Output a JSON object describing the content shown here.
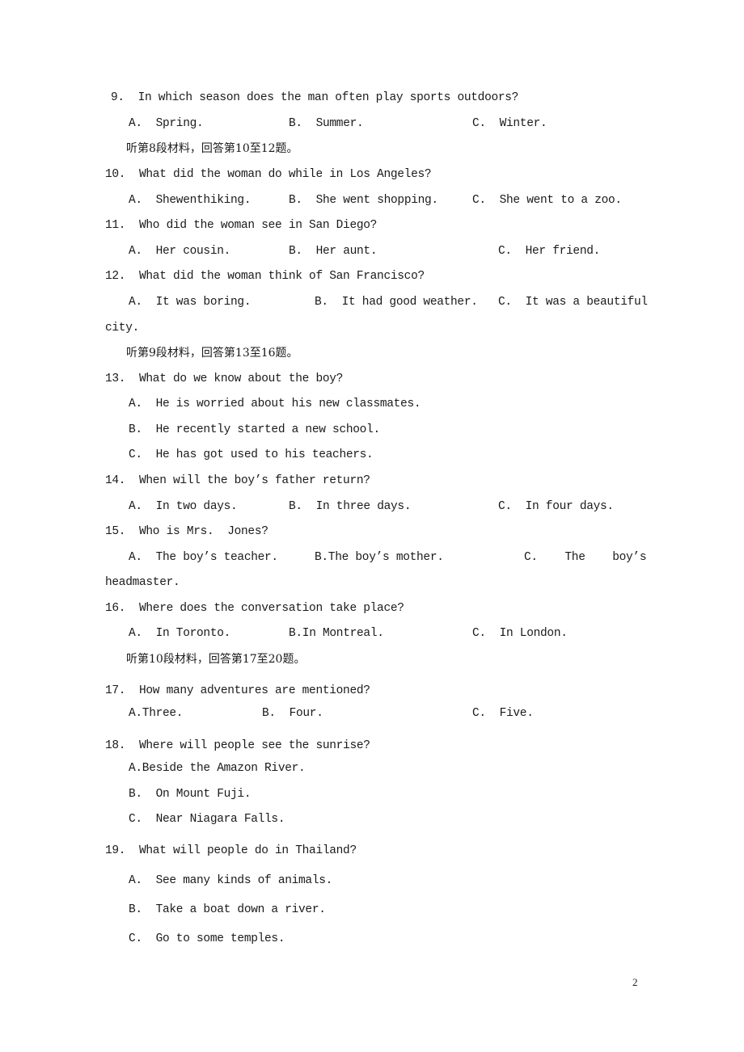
{
  "document": {
    "page_number": "2",
    "lines": [
      {
        "id": "q9",
        "text": "9.  In which season does the man often play sports outdoors?"
      },
      {
        "id": "q9a",
        "text": "A.  Spring."
      },
      {
        "id": "q9b",
        "text": "B.  Summer."
      },
      {
        "id": "q9c",
        "text": "C.  Winter."
      },
      {
        "id": "s8",
        "text": "听第8段材料，回答第10至12题。"
      },
      {
        "id": "q10",
        "text": "10.  What did the woman do while in Los Angeles?"
      },
      {
        "id": "q10a",
        "text": "A.  Shewenthiking."
      },
      {
        "id": "q10b",
        "text": "B.  She went shopping."
      },
      {
        "id": "q10c",
        "text": "C.  She went to a zoo."
      },
      {
        "id": "q11",
        "text": "11.  Who did the woman see in San Diego?"
      },
      {
        "id": "q11a",
        "text": "A.  Her cousin."
      },
      {
        "id": "q11b",
        "text": "B.  Her aunt."
      },
      {
        "id": "q11c",
        "text": "C.  Her friend."
      },
      {
        "id": "q12",
        "text": "12.  What did the woman think of San Francisco?"
      },
      {
        "id": "q12a",
        "text": "A.  It was boring."
      },
      {
        "id": "q12b",
        "text": "B.  It had good weather."
      },
      {
        "id": "q12c",
        "text": "C.  It was a beautiful"
      },
      {
        "id": "q12c2",
        "text": "city."
      },
      {
        "id": "s9",
        "text": "听第9段材料，回答第13至16题。"
      },
      {
        "id": "q13",
        "text": "13.  What do we know about the boy?"
      },
      {
        "id": "q13a",
        "text": "A.  He is worried about his new classmates."
      },
      {
        "id": "q13b",
        "text": "B.  He recently started a new school."
      },
      {
        "id": "q13c",
        "text": "C.  He has got used to his teachers."
      },
      {
        "id": "q14",
        "text": "14.  When will the boy’s father return?"
      },
      {
        "id": "q14a",
        "text": "A.  In two days."
      },
      {
        "id": "q14b",
        "text": "B.  In three days."
      },
      {
        "id": "q14c",
        "text": "C.  In four days."
      },
      {
        "id": "q15",
        "text": "15.  Who is Mrs.  Jones?"
      },
      {
        "id": "q15a",
        "text": "A.  The boy’s teacher."
      },
      {
        "id": "q15b",
        "text": "B.The boy’s mother."
      },
      {
        "id": "q15c",
        "text": "C.    The    boy’s"
      },
      {
        "id": "q15c2",
        "text": "headmaster."
      },
      {
        "id": "q16",
        "text": "16.  Where does the conversation take place?"
      },
      {
        "id": "q16a",
        "text": "A.  In Toronto."
      },
      {
        "id": "q16b",
        "text": "B.In Montreal."
      },
      {
        "id": "q16c",
        "text": "C.  In London."
      },
      {
        "id": "s10",
        "text": "听第10段材料，回答第17至20题。"
      },
      {
        "id": "q17",
        "text": "17.  How many adventures are mentioned?"
      },
      {
        "id": "q17a",
        "text": "A.Three."
      },
      {
        "id": "q17b",
        "text": "B.  Four."
      },
      {
        "id": "q17c",
        "text": "C.  Five."
      },
      {
        "id": "q18",
        "text": "18.  Where will people see the sunrise?"
      },
      {
        "id": "q18a",
        "text": "A.Beside the Amazon River."
      },
      {
        "id": "q18b",
        "text": "B.  On Mount Fuji."
      },
      {
        "id": "q18c",
        "text": "C.  Near Niagara Falls."
      },
      {
        "id": "q19",
        "text": "19.  What will people do in Thailand?"
      },
      {
        "id": "q19a",
        "text": "A.  See many kinds of animals."
      },
      {
        "id": "q19b",
        "text": "B.  Take a boat down a river."
      },
      {
        "id": "q19c",
        "text": "C.  Go to some temples."
      }
    ]
  }
}
